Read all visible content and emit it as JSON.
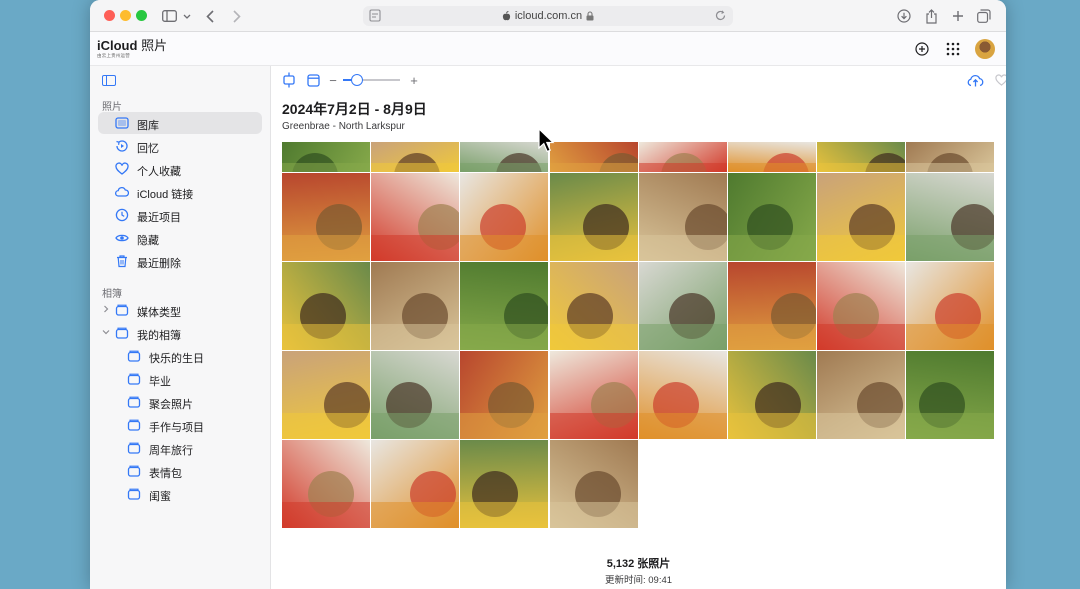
{
  "browser": {
    "url": "icloud.com.cn",
    "icons": [
      "sidebar-icon",
      "chevron-down-icon",
      "back-icon",
      "forward-icon",
      "download-icon",
      "share-icon",
      "new-tab-icon",
      "tabs-icon",
      "lock-icon",
      "reload-icon"
    ]
  },
  "app": {
    "brand": "iCloud",
    "section": "照片",
    "subtitle": "由云上贵州运营"
  },
  "sidebar": {
    "photos_heading": "照片",
    "items": [
      {
        "label": "图库",
        "icon": "library-icon",
        "selected": true
      },
      {
        "label": "回忆",
        "icon": "memories-icon"
      },
      {
        "label": "个人收藏",
        "icon": "heart-icon"
      },
      {
        "label": "iCloud 链接",
        "icon": "cloud-link-icon"
      },
      {
        "label": "最近项目",
        "icon": "clock-icon"
      },
      {
        "label": "隐藏",
        "icon": "eye-icon"
      },
      {
        "label": "最近删除",
        "icon": "trash-icon"
      }
    ],
    "albums_heading": "相簿",
    "groups": [
      {
        "label": "媒体类型",
        "expanded": false
      },
      {
        "label": "我的相簿",
        "expanded": true
      }
    ],
    "albums": [
      "快乐的生日",
      "毕业",
      "聚会照片",
      "手作与项目",
      "周年旅行",
      "表情包",
      "闺蜜"
    ]
  },
  "toolbar": {
    "zoom_minus": "−",
    "zoom_plus": "+",
    "zoom_level": 0.3
  },
  "content": {
    "date_range": "2024年7月2日 - 8月9日",
    "location": "Greenbrae - North Larkspur",
    "photo_count": "5,132 张照片",
    "updated": "更新时间: 09:41"
  },
  "colors": {
    "accent": "#3478f6",
    "selected_bg": "#e4e4e6",
    "desktop": "#6aa9c6"
  }
}
